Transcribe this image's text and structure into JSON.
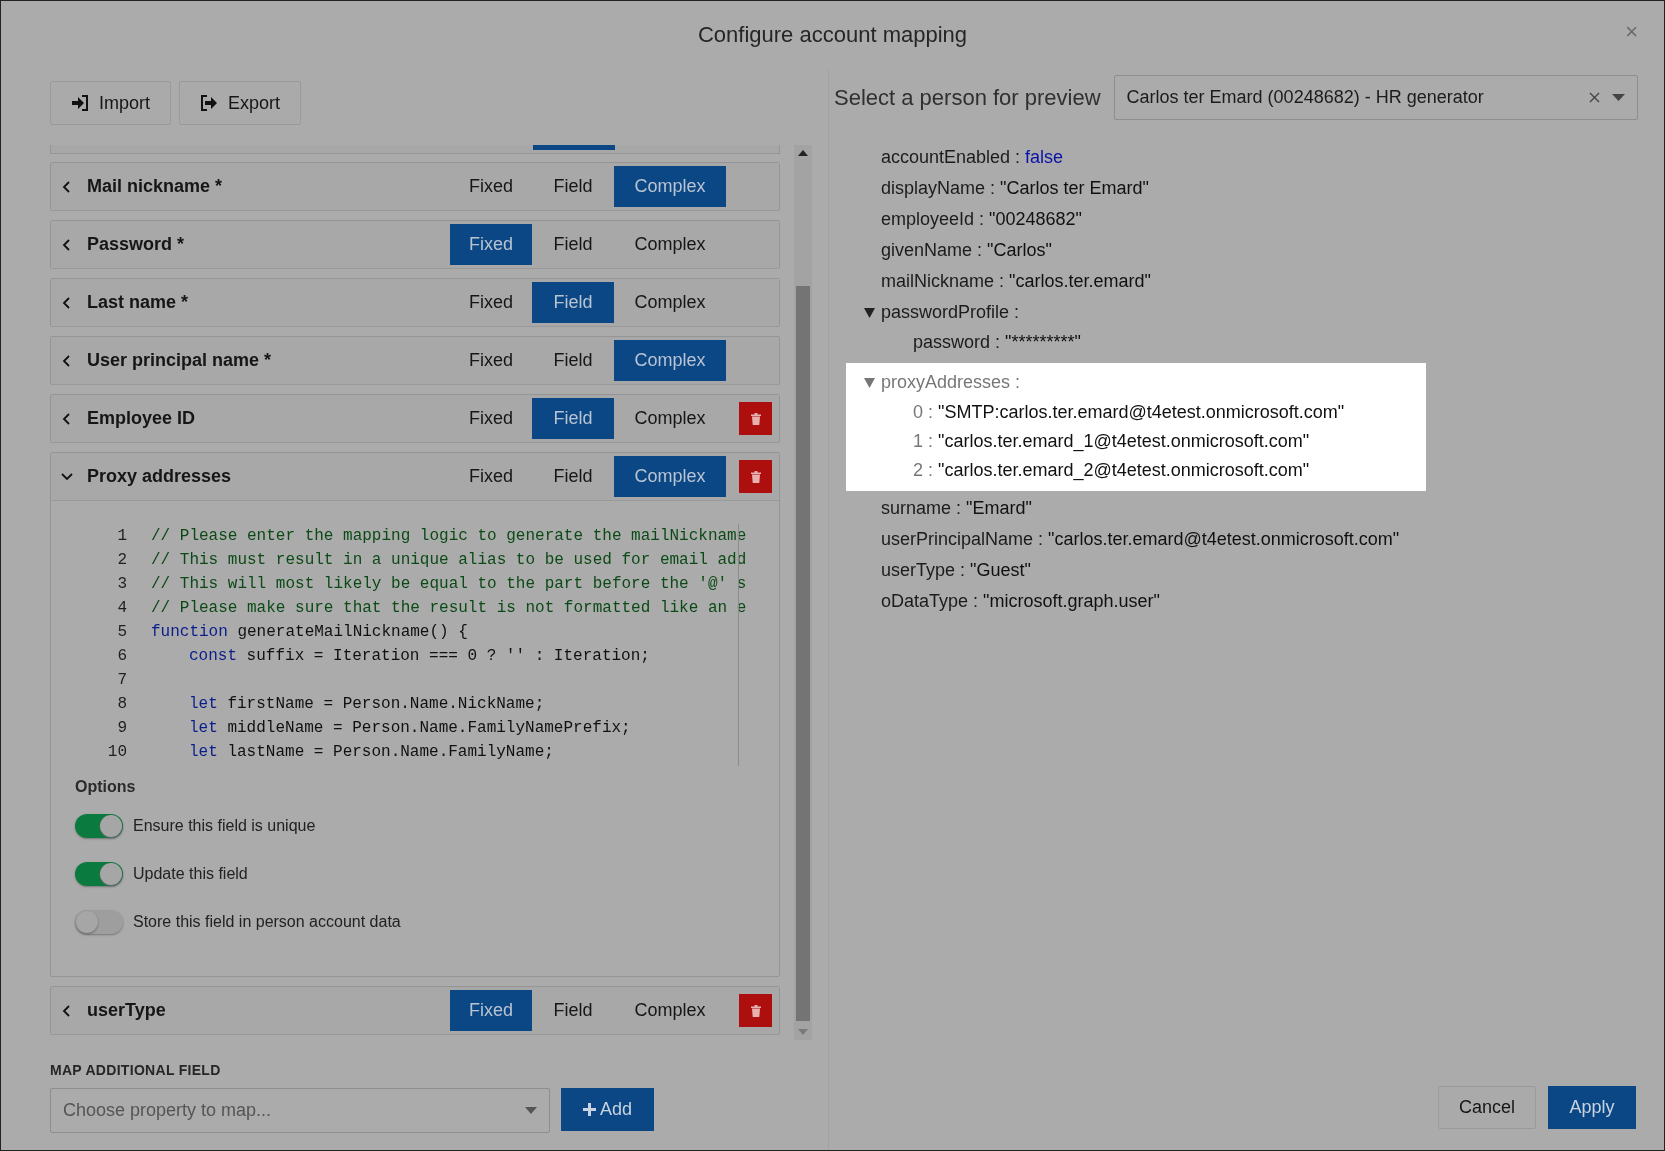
{
  "dialog": {
    "title": "Configure account mapping",
    "close": "×"
  },
  "toolbar": [
    {
      "label": "Import",
      "kind": "import"
    },
    {
      "label": "Export",
      "kind": "export"
    }
  ],
  "mappings": [
    {
      "label": "Mail nickname *",
      "expanded": false,
      "deletable": false,
      "modes": [
        {
          "label": "Fixed",
          "selected": false
        },
        {
          "label": "Field",
          "selected": false
        },
        {
          "label": "Complex",
          "selected": true
        }
      ]
    },
    {
      "label": "Password *",
      "expanded": false,
      "deletable": false,
      "modes": [
        {
          "label": "Fixed",
          "selected": true
        },
        {
          "label": "Field",
          "selected": false
        },
        {
          "label": "Complex",
          "selected": false
        }
      ]
    },
    {
      "label": "Last name *",
      "expanded": false,
      "deletable": false,
      "modes": [
        {
          "label": "Fixed",
          "selected": false
        },
        {
          "label": "Field",
          "selected": true
        },
        {
          "label": "Complex",
          "selected": false
        }
      ]
    },
    {
      "label": "User principal name *",
      "expanded": false,
      "deletable": false,
      "modes": [
        {
          "label": "Fixed",
          "selected": false
        },
        {
          "label": "Field",
          "selected": false
        },
        {
          "label": "Complex",
          "selected": true
        }
      ]
    },
    {
      "label": "Employee ID",
      "expanded": false,
      "deletable": true,
      "modes": [
        {
          "label": "Fixed",
          "selected": false
        },
        {
          "label": "Field",
          "selected": true
        },
        {
          "label": "Complex",
          "selected": false
        }
      ]
    },
    {
      "label": "Proxy addresses",
      "expanded": true,
      "deletable": true,
      "modes": [
        {
          "label": "Fixed",
          "selected": false
        },
        {
          "label": "Field",
          "selected": false
        },
        {
          "label": "Complex",
          "selected": true
        }
      ],
      "code": [
        {
          "number": "1",
          "kind": "comment",
          "text": "// Please enter the mapping logic to generate the mailNickname"
        },
        {
          "number": "2",
          "kind": "comment",
          "text": "// This must result in a unique alias to be used for email add"
        },
        {
          "number": "3",
          "kind": "comment",
          "text": "// This will most likely be equal to the part before the '@' s"
        },
        {
          "number": "4",
          "kind": "comment",
          "text": "// Please make sure that the result is not formatted like an e"
        },
        {
          "number": "5",
          "kind": "code",
          "keyword": "function",
          "text": " generateMailNickname() {"
        },
        {
          "number": "6",
          "kind": "code",
          "indented": true,
          "keyword": "const",
          "text": " suffix = Iteration === 0 ? '' : Iteration;"
        },
        {
          "number": "7",
          "kind": "blank"
        },
        {
          "number": "8",
          "kind": "code",
          "indented": true,
          "keyword": "let",
          "text": " firstName = Person.Name.NickName;"
        },
        {
          "number": "9",
          "kind": "code",
          "indented": true,
          "keyword": "let",
          "text": " middleName = Person.Name.FamilyNamePrefix;"
        },
        {
          "number": "10",
          "kind": "code",
          "indented": true,
          "keyword": "let",
          "text": " lastName = Person.Name.FamilyName;"
        }
      ],
      "options_title": "Options",
      "options": [
        {
          "label": "Ensure this field is unique",
          "on": true
        },
        {
          "label": "Update this field",
          "on": true
        },
        {
          "label": "Store this field in person account data",
          "on": false
        }
      ]
    },
    {
      "label": "userType",
      "expanded": false,
      "deletable": true,
      "modes": [
        {
          "label": "Fixed",
          "selected": true
        },
        {
          "label": "Field",
          "selected": false
        },
        {
          "label": "Complex",
          "selected": false
        }
      ]
    }
  ],
  "map_additional": {
    "title": "MAP ADDITIONAL FIELD",
    "placeholder": "Choose property to map...",
    "add": "Add"
  },
  "preview": {
    "label": "Select a person for preview",
    "person": "Carlos ter Emard (00248682) - HR generator",
    "tree": [
      {
        "key": "accountEnabled :",
        "kind": "boolean",
        "value": "false"
      },
      {
        "key": "displayName :",
        "kind": "string",
        "value": "\"Carlos ter Emard\""
      },
      {
        "key": "employeeId :",
        "kind": "string",
        "value": "\"00248682\""
      },
      {
        "key": "givenName :",
        "kind": "string",
        "value": "\"Carlos\""
      },
      {
        "key": "mailNickname :",
        "kind": "string",
        "value": "\"carlos.ter.emard\""
      },
      {
        "key": "passwordProfile :",
        "kind": "object",
        "expanded": true,
        "children": [
          {
            "key": "password :",
            "kind": "string",
            "value": "\"*********\""
          }
        ]
      },
      {
        "key": "proxyAddresses :",
        "kind": "object",
        "expanded": true,
        "highlighted": true,
        "children": [
          {
            "key": "0 :",
            "kind": "string",
            "value": "\"SMTP:carlos.ter.emard@t4etest.onmicrosoft.com\""
          },
          {
            "key": "1 :",
            "kind": "string",
            "value": "\"carlos.ter.emard_1@t4etest.onmicrosoft.com\""
          },
          {
            "key": "2 :",
            "kind": "string",
            "value": "\"carlos.ter.emard_2@t4etest.onmicrosoft.com\""
          }
        ]
      },
      {
        "key": "surname :",
        "kind": "string",
        "value": "\"Emard\""
      },
      {
        "key": "userPrincipalName :",
        "kind": "string",
        "value": "\"carlos.ter.emard@t4etest.onmicrosoft.com\""
      },
      {
        "key": "userType :",
        "kind": "string",
        "value": "\"Guest\""
      },
      {
        "key": "oDataType :",
        "kind": "string",
        "value": "\"microsoft.graph.user\""
      }
    ]
  },
  "footer": {
    "cancel": "Cancel",
    "apply": "Apply"
  }
}
